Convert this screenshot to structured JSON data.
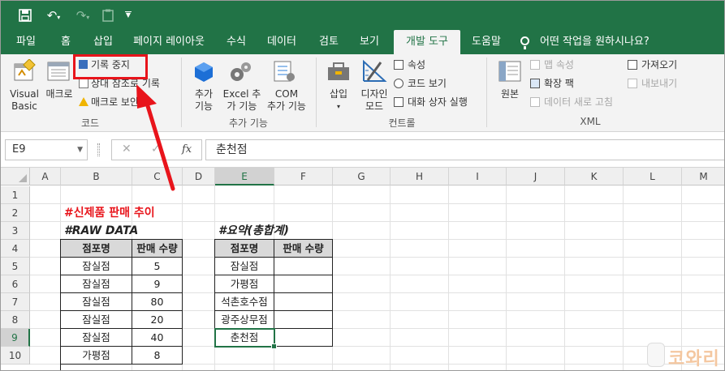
{
  "qat": {
    "save": "💾",
    "undo": "↶",
    "redo": "↷",
    "more": "▼"
  },
  "tabs": [
    "파일",
    "홈",
    "삽입",
    "페이지 레이아웃",
    "수식",
    "데이터",
    "검토",
    "보기",
    "개발 도구",
    "도움말",
    "어떤 작업을 원하시나요?"
  ],
  "ribbon": {
    "code": {
      "visual_basic": [
        "Visual",
        "Basic"
      ],
      "macro": "매크로",
      "stop_recording": "기록 중지",
      "relative_ref": "상대 참조로 기록",
      "macro_security": "매크로 보안",
      "label": "코드"
    },
    "addins": {
      "addins": [
        "추가",
        "기능"
      ],
      "excel_addins": [
        "Excel 추",
        "가 기능"
      ],
      "com_addins": [
        "COM",
        "추가 기능"
      ],
      "label": "추가 기능"
    },
    "controls": {
      "insert": "삽입",
      "design_mode": [
        "디자인",
        "모드"
      ],
      "properties": "속성",
      "view_code": "코드 보기",
      "run_dialog": "대화 상자 실행",
      "label": "컨트롤"
    },
    "xml": {
      "source": "원본",
      "map_properties": "맵 속성",
      "expansion_packs": "확장 팩",
      "refresh_data": "데이터 새로 고침",
      "import": "가져오기",
      "export": "내보내기",
      "label": "XML"
    }
  },
  "formula_bar": {
    "name_box": "E9",
    "cancel": "✕",
    "enter": "✓",
    "fx": "fx",
    "content": "춘천점"
  },
  "columns": [
    "A",
    "B",
    "C",
    "D",
    "E",
    "F",
    "G",
    "H",
    "I",
    "J",
    "K",
    "L",
    "M"
  ],
  "rows": [
    "1",
    "2",
    "3",
    "4",
    "5",
    "6",
    "7",
    "8",
    "9",
    "10"
  ],
  "sheet": {
    "title_new_product": "#신제품 판매 추이",
    "title_raw": "#RAW DATA",
    "title_summary": "#요약(총합계)",
    "raw_headers": [
      "점포명",
      "판매 수량"
    ],
    "raw_rows": [
      [
        "잠실점",
        "5"
      ],
      [
        "잠실점",
        "9"
      ],
      [
        "잠실점",
        "80"
      ],
      [
        "잠실점",
        "20"
      ],
      [
        "잠실점",
        "40"
      ],
      [
        "가평점",
        "8"
      ]
    ],
    "summary_headers": [
      "점포명",
      "판매 수량"
    ],
    "summary_rows": [
      "잠실점",
      "가평점",
      "석촌호수점",
      "광주상무점",
      "춘천점"
    ]
  },
  "colors": {
    "accent": "#217346",
    "annotation": "#e8141b"
  },
  "watermark": "코와리"
}
